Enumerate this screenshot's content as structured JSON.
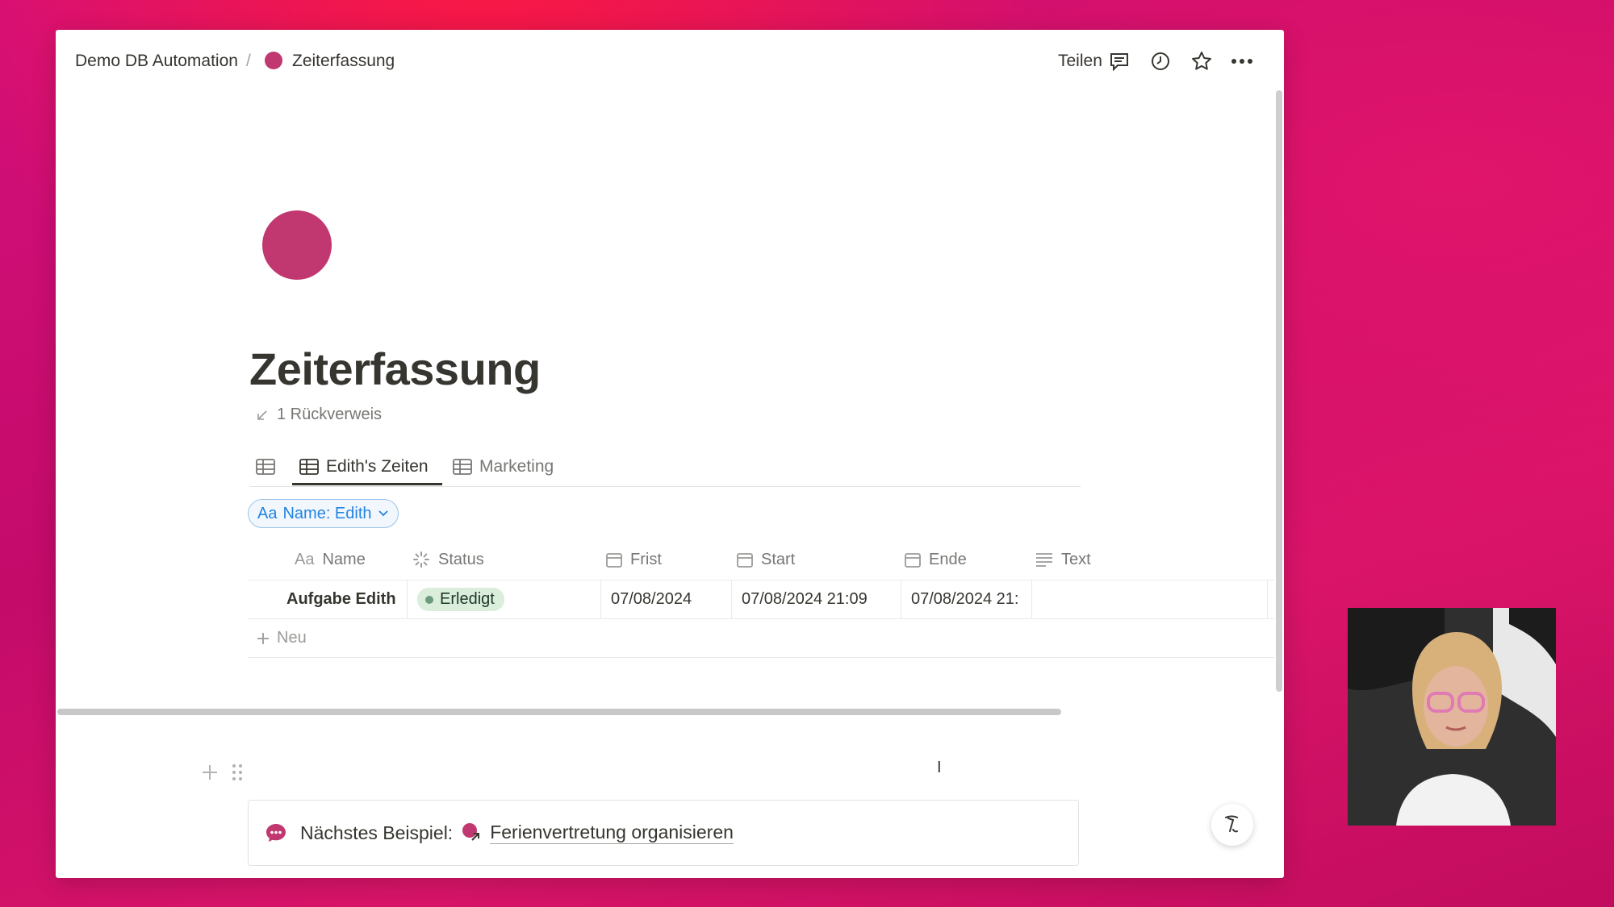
{
  "breadcrumb": {
    "workspace": "Demo DB Automation",
    "separator": "/",
    "page": "Zeiterfassung"
  },
  "topbar": {
    "share_label": "Teilen"
  },
  "page": {
    "title": "Zeiterfassung",
    "backlinks": "1 Rückverweis",
    "icon_color": "#c0386f"
  },
  "views": {
    "tabs": [
      {
        "label": "Edith's Zeiten"
      },
      {
        "label": "Marketing"
      }
    ]
  },
  "filter": {
    "label": "Name: Edith",
    "prefix": "Aa"
  },
  "table": {
    "columns": [
      {
        "label": "Name",
        "prefix": "Aa"
      },
      {
        "label": "Status"
      },
      {
        "label": "Frist"
      },
      {
        "label": "Start"
      },
      {
        "label": "Ende"
      },
      {
        "label": "Text"
      }
    ],
    "rows": [
      {
        "name": "Aufgabe Edith",
        "status": "Erledigt",
        "frist": "07/08/2024",
        "start": "07/08/2024 21:09",
        "ende": "07/08/2024 21:",
        "text": ""
      }
    ],
    "new_label": "Neu"
  },
  "callout": {
    "prefix": "Nächstes Beispiel:",
    "link": "Ferienvertretung organisieren"
  },
  "colors": {
    "accent": "#c0386f",
    "status_done_bg": "#dbeddb",
    "link_blue": "#2383e2"
  }
}
